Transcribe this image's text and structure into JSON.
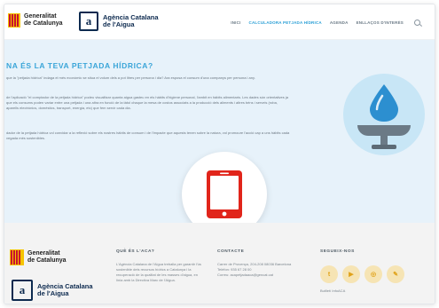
{
  "header": {
    "generalitat_logo": [
      "Generalitat",
      "de Catalunya"
    ],
    "aca_logo": [
      "Agència Catalana",
      "de l'Aigua"
    ],
    "nav": [
      "INICI",
      "CALCULADORA PETJADA HÍDRICA",
      "AGENDA",
      "ENLLAÇOS D'INTERÈS"
    ],
    "active_nav": 1
  },
  "hero": {
    "title": "NA ÉS LA TEVA PETJADA HÍDRICA?",
    "paragraphs": [
      "que la \"petjada hídrica\" indaga el més econòmic se situa el volum dels a pot litres per persona i dia? Ara esposa el consum d'una companys per persona i any.",
      "de l'aplicació \"el comptador de la petjada hídrica\" podeu visualitzar quanta aigua gasteu en els hàbits d'higiene personal, l'ambit en hàbits alimentaris. Les dades són orientatives ja que els consums poden variar entre una petjada i una altra en funció de la tàtol chaque la mesa de costos associats a la producció dels aliments i altres béns i serveis (roba, aparells electrònics, domèstics, transport, energia, etc) que fem servir cada dia.",
      "dador de la petjada hídrica vol convidar a la reflexió sobre els nostres hàbits de consum i de l'impacte que aquests tenen sobre la natura, vol promoure l'acció cap a uns hàbits cada vegada més sostenibles."
    ]
  },
  "footer": {
    "generalitat_logo": [
      "Generalitat",
      "de Catalunya"
    ],
    "aca_logo": [
      "Agència Catalana",
      "de l'Aigua"
    ],
    "col1": {
      "heading": "QUÈ ÉS L'ACA?",
      "text": "L'Agència Catalana de l'Aigua treballa per garantir l'ús sostenible dels recursos hídrics a Catalunya i la recuperació de la qualitat de les masses d'aigua, en línia amb la Directiva Marc de l'Aigua."
    },
    "col2": {
      "heading": "CONTACTE",
      "lines": [
        "Carrer de Provença, 204-208 08036 Barcelona",
        "Telèfon: 935 67 28 00",
        "Correu: acapetjadaaca@gencat.cat"
      ]
    },
    "col3": {
      "heading": "SEGUEIX-NOS",
      "social": [
        "twitter-icon",
        "youtube-icon",
        "instagram-icon",
        "blog-icon"
      ],
      "text": "Butlletí InfoACA"
    }
  },
  "colors": {
    "accent": "#2a9fd6",
    "phone": "#e1251b",
    "hero_bg": "#e7f2fa",
    "footer_bg": "#f3f3f3"
  }
}
